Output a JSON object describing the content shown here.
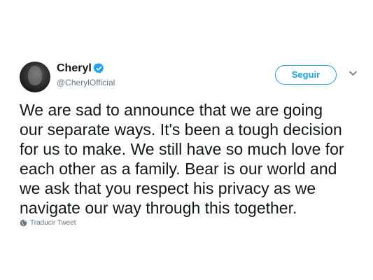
{
  "author": {
    "display_name": "Cheryl",
    "handle": "@CherylOfficial",
    "verified": true,
    "avatar_icon": "user-avatar-photo"
  },
  "actions": {
    "follow_label": "Seguir",
    "more_icon": "chevron-down-icon"
  },
  "tweet": {
    "text": "We are sad to announce that we are going\nour separate ways. It's been a tough decision\nfor us to make. We still have so much love for\neach other as a family.  Bear is our world and\nwe ask that you respect his privacy as we\nnavigate our way through this together."
  },
  "translate": {
    "label": "Traducir Tweet",
    "icon": "globe-icon"
  },
  "colors": {
    "accent": "#1da1f2",
    "text_primary": "#14171a",
    "text_secondary": "#657786"
  }
}
